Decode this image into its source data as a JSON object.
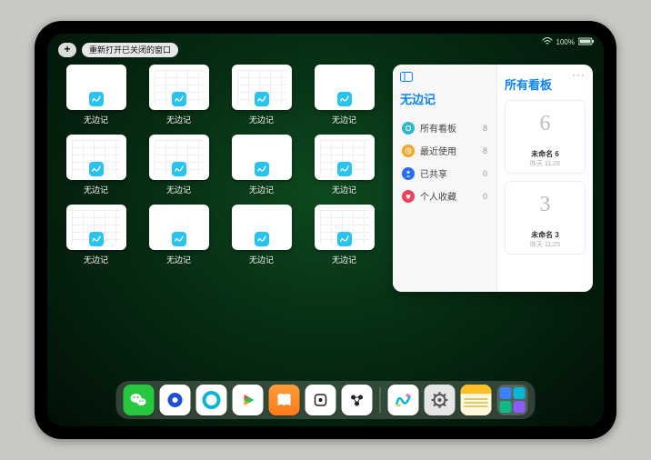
{
  "status": {
    "wifi": "wifi",
    "battery": "100%"
  },
  "top": {
    "plus": "+",
    "reopen": "重新打开已关闭的窗口"
  },
  "app_label": "无边记",
  "windows": [
    {
      "style": "blank"
    },
    {
      "style": "cal"
    },
    {
      "style": "cal"
    },
    {
      "style": "blank"
    },
    {
      "style": "cal"
    },
    {
      "style": "cal"
    },
    {
      "style": "blank"
    },
    {
      "style": "cal"
    },
    {
      "style": "cal"
    },
    {
      "style": "blank"
    },
    {
      "style": "blank"
    },
    {
      "style": "cal"
    }
  ],
  "panel": {
    "left_title": "无边记",
    "items": [
      {
        "label": "所有看板",
        "count": 8,
        "icon": "circle",
        "color": "#2ab7ca"
      },
      {
        "label": "最近使用",
        "count": 8,
        "icon": "clock",
        "color": "#f5a623"
      },
      {
        "label": "已共享",
        "count": 0,
        "icon": "person",
        "color": "#2a6df5"
      },
      {
        "label": "个人收藏",
        "count": 0,
        "icon": "heart",
        "color": "#f0405f"
      }
    ],
    "right_title": "所有看板",
    "boards": [
      {
        "glyph": "6",
        "name": "未命名 6",
        "date": "昨天 11:26"
      },
      {
        "glyph": "3",
        "name": "未命名 3",
        "date": "昨天 11:25"
      }
    ],
    "more": "···"
  },
  "dock": [
    {
      "name": "wechat-icon",
      "bg": "#27c840",
      "glyph": "wechat"
    },
    {
      "name": "browser1-icon",
      "bg": "#ffffff",
      "glyph": "bluecircle"
    },
    {
      "name": "browser2-icon",
      "bg": "#ffffff",
      "glyph": "cyancircle"
    },
    {
      "name": "play-icon",
      "bg": "#ffffff",
      "glyph": "play"
    },
    {
      "name": "books-icon",
      "bg": "linear-gradient(#ff9b3a,#ff7a1a)",
      "glyph": "books"
    },
    {
      "name": "dice-icon",
      "bg": "#ffffff",
      "glyph": "dice"
    },
    {
      "name": "atoms-icon",
      "bg": "#ffffff",
      "glyph": "atoms"
    },
    {
      "sep": true
    },
    {
      "name": "freeform-icon",
      "bg": "#ffffff",
      "glyph": "scribble"
    },
    {
      "name": "settings-icon",
      "bg": "#e6e6e9",
      "glyph": "gear"
    },
    {
      "name": "notes-icon",
      "bg": "#ffffff",
      "glyph": "notes"
    },
    {
      "name": "app-library-icon",
      "bg": "rgba(255,255,255,.18)",
      "glyph": "applibrary"
    }
  ],
  "colors": {
    "accent": "#0a84ff"
  }
}
